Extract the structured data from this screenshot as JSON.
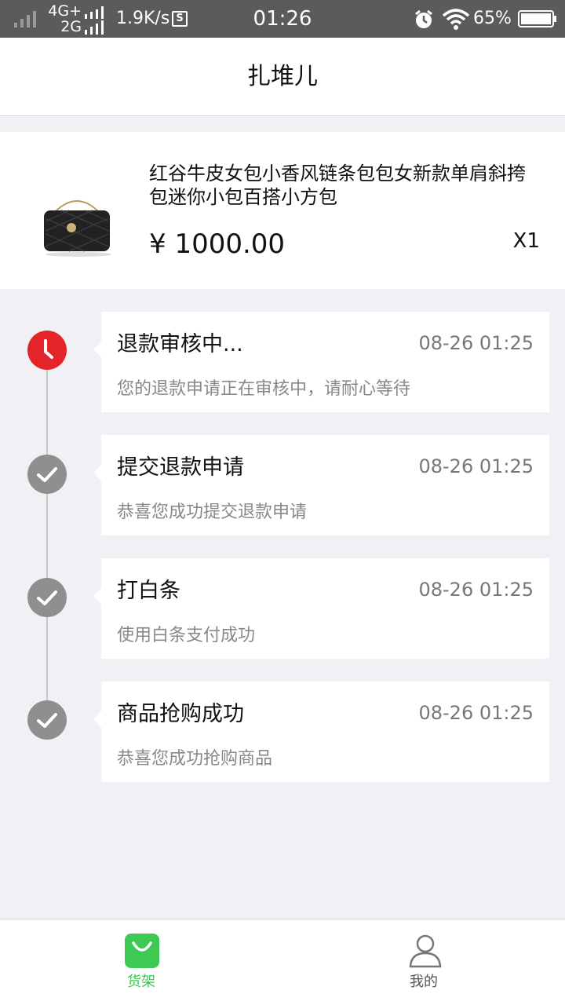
{
  "status_bar": {
    "network_top": "4G+",
    "network_bottom": "2G",
    "speed": "1.9K/s",
    "sim_icon_letter": "S",
    "time": "01:26",
    "battery_percent": "65%"
  },
  "nav": {
    "title": "扎堆儿"
  },
  "product": {
    "name": "红谷牛皮女包小香风链条包包女新款单肩斜挎包迷你小包百搭小方包",
    "price": "¥ 1000.00",
    "quantity": "X1",
    "image_icon": "black-quilted-handbag"
  },
  "timeline": [
    {
      "title": "退款审核中...",
      "time": "08-26 01:25",
      "desc": "您的退款申请正在审核中，请耐心等待",
      "status": "active",
      "icon": "clock-icon"
    },
    {
      "title": "提交退款申请",
      "time": "08-26 01:25",
      "desc": "恭喜您成功提交退款申请",
      "status": "done",
      "icon": "check-icon"
    },
    {
      "title": "打白条",
      "time": "08-26 01:25",
      "desc": "使用白条支付成功",
      "status": "done",
      "icon": "check-icon"
    },
    {
      "title": "商品抢购成功",
      "time": "08-26 01:25",
      "desc": "恭喜您成功抢购商品",
      "status": "done",
      "icon": "check-icon"
    }
  ],
  "tabs": [
    {
      "label": "货架",
      "icon": "shopping-bag-icon",
      "selected": true
    },
    {
      "label": "我的",
      "icon": "person-icon",
      "selected": false
    }
  ],
  "colors": {
    "accent_green": "#3dc953",
    "active_red": "#e5242a",
    "done_gray": "#8f8f8f",
    "status_bar": "#5b5b5b",
    "page_background": "#f1f1f5"
  }
}
